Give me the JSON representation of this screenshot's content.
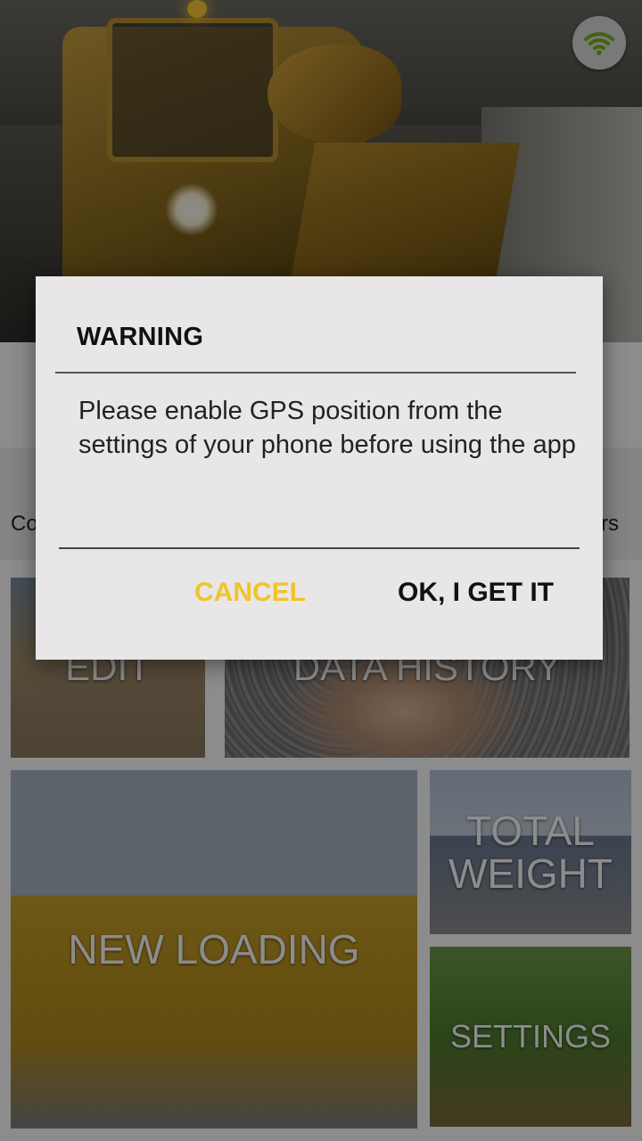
{
  "header": {
    "wifi_icon": "wifi-icon",
    "wifi_color": "#7cb51c"
  },
  "info_bar": {
    "left_text": "Co",
    "right_text": "rs"
  },
  "tiles": {
    "edit": "EDIT",
    "data_history": "DATA HISTORY",
    "new_loading": "NEW LOADING",
    "total_weight_line1": "TOTAL",
    "total_weight_line2": "WEIGHT",
    "settings": "SETTINGS"
  },
  "dialog": {
    "title": "WARNING",
    "message": "Please enable GPS position from the settings of your phone before using the app",
    "cancel_label": "CANCEL",
    "ok_label": "OK, I GET IT"
  },
  "colors": {
    "accent_yellow": "#f0c42a",
    "dialog_bg": "#e8e6e6",
    "dim_overlay": "rgba(0,0,0,0.45)"
  }
}
